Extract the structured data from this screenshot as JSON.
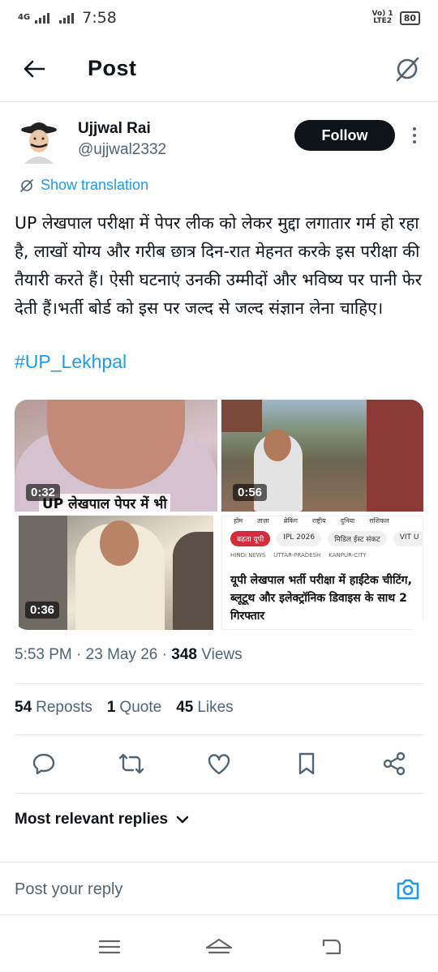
{
  "status_bar": {
    "network": "4G",
    "time": "7:58",
    "volte": "Vo) 1",
    "lte": "LTE2",
    "battery": "80"
  },
  "header": {
    "title": "Post",
    "back_icon": "arrow-left-icon",
    "grok_icon": "grok-icon"
  },
  "author": {
    "name": "Ujjwal Rai",
    "handle": "@ujjwal2332",
    "follow_label": "Follow"
  },
  "translate_label": "Show translation",
  "post": {
    "text": "UP लेखपाल परीक्षा में पेपर लीक को लेकर मुद्दा लगातार गर्म हो रहा है, लाखों योग्य और गरीब छात्र दिन-रात मेहनत करके इस परीक्षा की तैयारी करते हैं। ऐसी घटनाएं उनकी उम्मीदों और भविष्य पर पानी फेर देती हैं।भर्ती बोर्ड को इस पर जल्द से जल्द संज्ञान लेना चाहिए।",
    "hashtag": "#UP_Lekhpal"
  },
  "media": {
    "items": [
      {
        "duration": "0:32",
        "caption": "UP लेखपाल पेपर में भी"
      },
      {
        "duration": "0:56"
      },
      {
        "duration": "0:36"
      },
      {
        "nav": [
          "होम",
          "ताज़ा",
          "ब्रेकिंग",
          "राष्ट्रीय",
          "दुनिया",
          "राशिफल"
        ],
        "chips": [
          "बढ़ता यूपी",
          "IPL 2026",
          "मिडिल ईस्ट संकट",
          "VIT U"
        ],
        "crumbs": [
          "HINDI NEWS",
          "UTTAR-PRADESH",
          "KANPUR-CITY"
        ],
        "headline": "यूपी लेखपाल भर्ती परीक्षा में हाईटेक चीटिंग, ब्लूटूथ और इलेक्ट्रॉनिक डिवाइस के साथ 2 गिरफ्तार"
      }
    ]
  },
  "meta": {
    "time": "5:53 PM",
    "date": "23 May 26",
    "views_count": "348",
    "views_label": "Views"
  },
  "stats": {
    "reposts_count": "54",
    "reposts_label": "Reposts",
    "quotes_count": "1",
    "quotes_label": "Quote",
    "likes_count": "45",
    "likes_label": "Likes"
  },
  "actions": [
    "reply-icon",
    "repost-icon",
    "like-icon",
    "bookmark-icon",
    "share-icon"
  ],
  "replies_sort": {
    "label": "Most relevant replies"
  },
  "composer": {
    "placeholder": "Post your reply"
  },
  "colors": {
    "accent": "#1d9bf0",
    "text": "#0f1419",
    "muted": "#536471"
  }
}
